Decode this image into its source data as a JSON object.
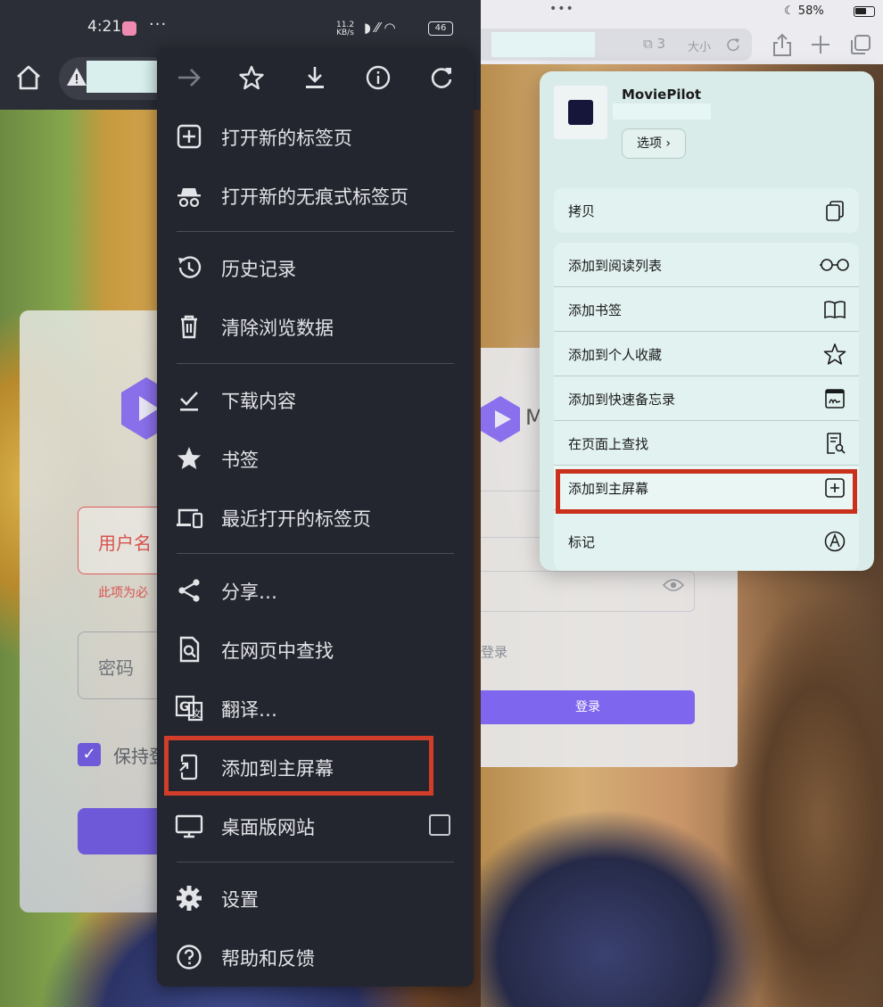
{
  "left": {
    "status": {
      "time": "4:21",
      "dots": "···",
      "speed_top": "11.2",
      "speed_bottom": "KB/s",
      "battery": "46"
    },
    "login": {
      "username_placeholder": "用户名",
      "error": "此项为必",
      "password_placeholder": "密码",
      "remember": "保持登"
    },
    "menu": {
      "top_icons": [
        "forward-icon",
        "star-icon",
        "download-icon",
        "info-icon",
        "refresh-icon"
      ],
      "items": [
        {
          "label": "打开新的标签页",
          "icon": "new-tab-icon"
        },
        {
          "label": "打开新的无痕式标签页",
          "icon": "incognito-icon"
        },
        {
          "label": "历史记录",
          "icon": "history-icon"
        },
        {
          "label": "清除浏览数据",
          "icon": "trash-icon"
        },
        {
          "label": "下载内容",
          "icon": "download-done-icon"
        },
        {
          "label": "书签",
          "icon": "star-filled-icon"
        },
        {
          "label": "最近打开的标签页",
          "icon": "devices-icon"
        },
        {
          "label": "分享…",
          "icon": "share-icon"
        },
        {
          "label": "在网页中查找",
          "icon": "find-in-page-icon"
        },
        {
          "label": "翻译…",
          "icon": "translate-icon"
        },
        {
          "label": "添加到主屏幕",
          "icon": "add-to-home-icon"
        },
        {
          "label": "桌面版网站",
          "icon": "desktop-icon"
        },
        {
          "label": "设置",
          "icon": "gear-icon"
        },
        {
          "label": "帮助和反馈",
          "icon": "help-icon"
        }
      ],
      "highlight_color": "#d03d2a"
    }
  },
  "right": {
    "status": {
      "dots": "•••",
      "battery": "58%"
    },
    "toolbar": {
      "ext_count": "3",
      "text_size": "大小"
    },
    "login": {
      "m_letter": "M",
      "login_label": "登录",
      "login_button": "登录"
    },
    "share": {
      "app_name": "MoviePilot",
      "options_label": "选项 ›",
      "copy": "拷贝",
      "items": [
        {
          "label": "添加到阅读列表",
          "icon": "glasses-icon"
        },
        {
          "label": "添加书签",
          "icon": "book-icon"
        },
        {
          "label": "添加到个人收藏",
          "icon": "star-outline-icon"
        },
        {
          "label": "添加到快速备忘录",
          "icon": "quick-note-icon"
        },
        {
          "label": "在页面上查找",
          "icon": "find-doc-icon"
        },
        {
          "label": "添加到主屏幕",
          "icon": "plus-square-icon"
        }
      ],
      "markup": "标记",
      "highlight_color": "#c9311d"
    }
  }
}
